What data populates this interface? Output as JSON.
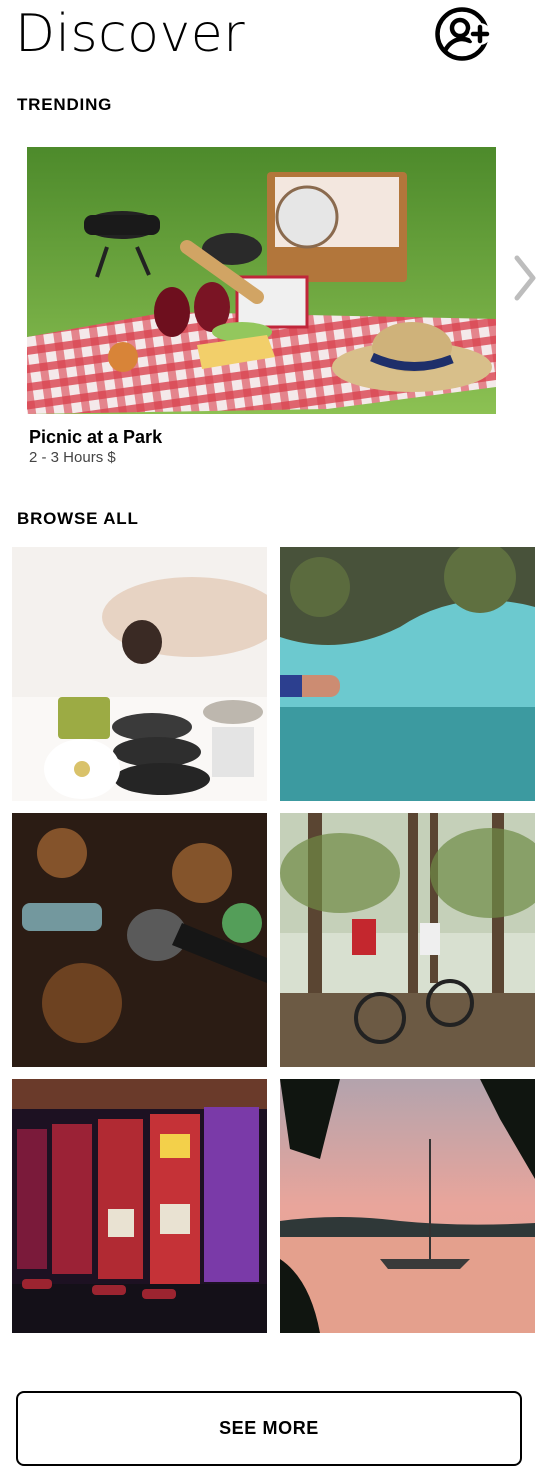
{
  "header": {
    "title": "Discover",
    "add_user_icon": "add-user-icon"
  },
  "trending": {
    "section_title": "TRENDING",
    "card": {
      "image": "picnic-image",
      "name": "Picnic at a Park",
      "meta": "2 - 3 Hours $"
    },
    "next_icon": "chevron-right-icon"
  },
  "browse": {
    "section_title": "BROWSE ALL",
    "tiles": [
      {
        "image": "spa-massage-image"
      },
      {
        "image": "swimming-pool-image"
      },
      {
        "image": "karaoke-microphone-image"
      },
      {
        "image": "forest-cycling-image"
      },
      {
        "image": "casino-slot-machines-image"
      },
      {
        "image": "sailboat-sunset-image"
      }
    ]
  },
  "footer": {
    "see_more_label": "SEE MORE"
  },
  "colors": {
    "text": "#000000",
    "secondary_text": "#444444",
    "arrow": "#bdbdbd",
    "background": "#ffffff"
  }
}
